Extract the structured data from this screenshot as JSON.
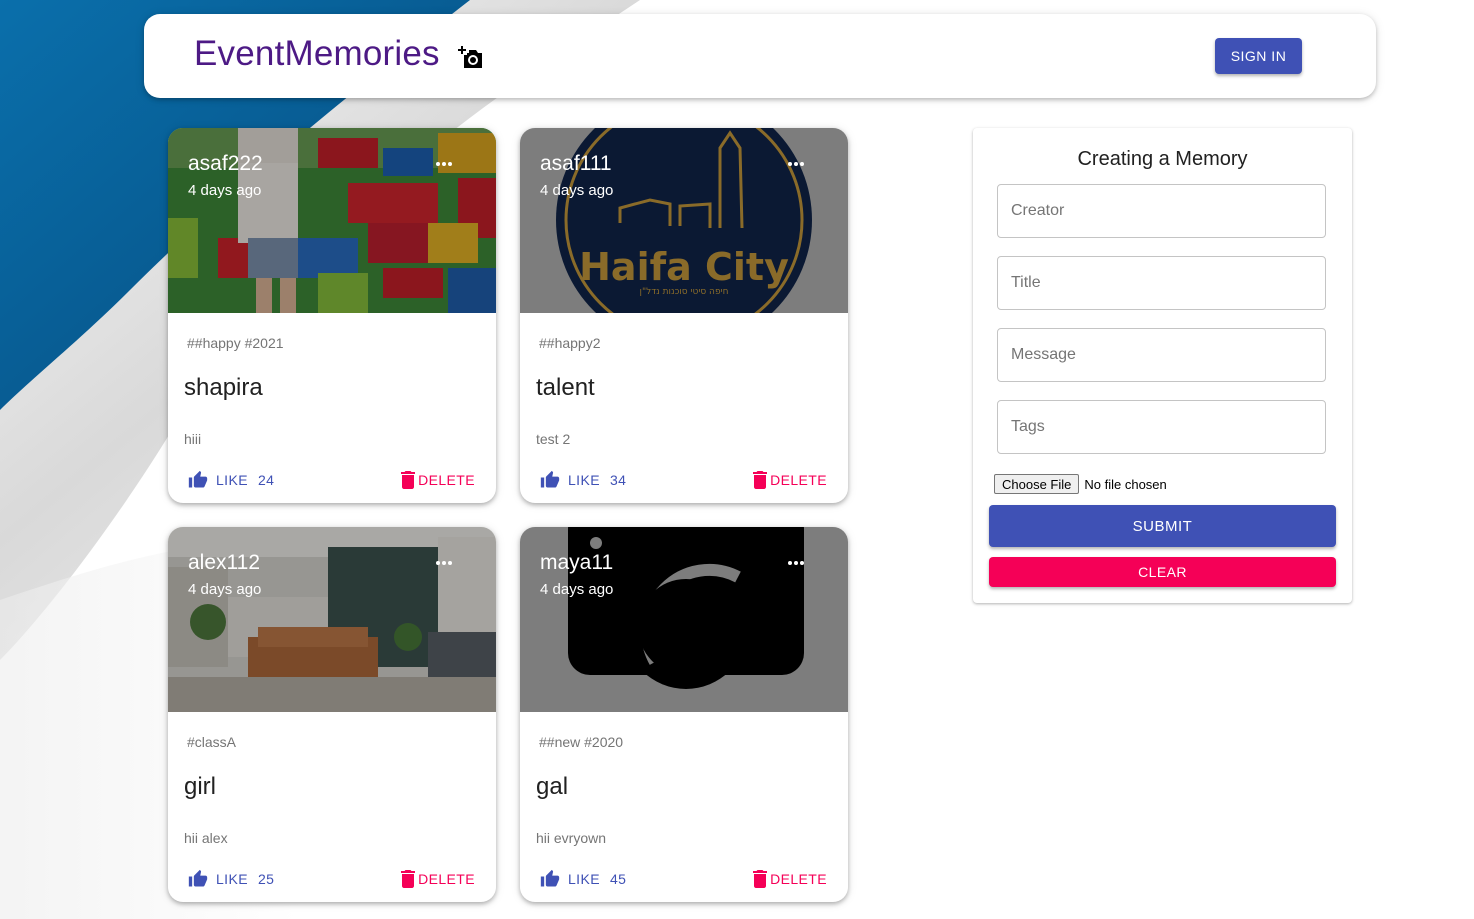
{
  "colors": {
    "brand": "#4d1a85",
    "primary": "#3f51b5",
    "secondary": "#f50057"
  },
  "appbar": {
    "brand": "EventMemories",
    "brand_icon": "add-a-photo-icon",
    "signin_label": "SIGN IN"
  },
  "posts": [
    {
      "creator": "asaf222",
      "time": "4 days ago",
      "tags": "##happy #2021",
      "title": "shapira",
      "message": "hiii",
      "like_label": "LIKE",
      "like_count": "24",
      "delete_label": "DELETE"
    },
    {
      "creator": "asaf111",
      "time": "4 days ago",
      "tags": "##happy2",
      "title": "talent",
      "message": "test 2",
      "like_label": "LIKE",
      "like_count": "34",
      "delete_label": "DELETE",
      "image_text": "Haifa City",
      "image_subtext": "חיפה סיטי סוכנות נדל\"ן"
    },
    {
      "creator": "alex112",
      "time": "4 days ago",
      "tags": "#classA",
      "title": "girl",
      "message": "hii alex",
      "like_label": "LIKE",
      "like_count": "25",
      "delete_label": "DELETE"
    },
    {
      "creator": "maya11",
      "time": "4 days ago",
      "tags": "##new #2020",
      "title": "gal",
      "message": "hii evryown",
      "like_label": "LIKE",
      "like_count": "45",
      "delete_label": "DELETE"
    }
  ],
  "form": {
    "title": "Creating a Memory",
    "creator_placeholder": "Creator",
    "title_placeholder": "Title",
    "message_placeholder": "Message",
    "tags_placeholder": "Tags",
    "file_button": "Choose File",
    "file_status": "No file chosen",
    "submit_label": "SUBMIT",
    "clear_label": "CLEAR"
  }
}
